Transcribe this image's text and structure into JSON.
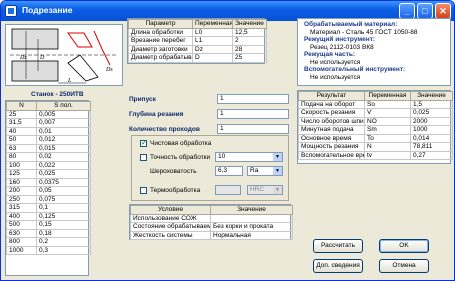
{
  "window": {
    "title": "Подрезание"
  },
  "geo_table": {
    "headers": [
      "Параметр",
      "Переменная",
      "Значение"
    ],
    "rows": [
      [
        "Длина обработки",
        "L0",
        "12,5"
      ],
      [
        "Врезание перебег",
        "L1",
        "2"
      ],
      [
        "Диаметр заготовки",
        "Dz",
        "28"
      ],
      [
        "Диаметр обрабатываемой",
        "D",
        "25"
      ]
    ]
  },
  "material": {
    "h1": "Обрабатываемый материал:",
    "v1": "Материал - Сталь 45 ГОСТ 1050-88",
    "h2": "Режущий инструмент:",
    "v2": "Резец 2112-0103 ВК8",
    "h3": "Режущая часть:",
    "v3": "Не используется",
    "h4": "Вспомогательный инструмент:",
    "v4": "Не используется"
  },
  "machine": {
    "title": "Станок - 250ИТВ",
    "headers": [
      "N",
      "S пол."
    ],
    "rows": [
      [
        "25",
        "0,005"
      ],
      [
        "31,5",
        "0,007"
      ],
      [
        "40",
        "0,01"
      ],
      [
        "50",
        "0,012"
      ],
      [
        "63",
        "0,015"
      ],
      [
        "80",
        "0,02"
      ],
      [
        "100",
        "0,022"
      ],
      [
        "125",
        "0,025"
      ],
      [
        "160",
        "0,0375"
      ],
      [
        "200",
        "0,05"
      ],
      [
        "250",
        "0,075"
      ],
      [
        "315",
        "0,1"
      ],
      [
        "400",
        "0,125"
      ],
      [
        "500",
        "0,15"
      ],
      [
        "630",
        "0,18"
      ],
      [
        "800",
        "0,2"
      ],
      [
        "1000",
        "0,3"
      ]
    ]
  },
  "inputs": {
    "pripusk_label": "Припуск",
    "pripusk_value": "1",
    "glubina_label": "Глубина резания",
    "glubina_value": "1",
    "prohodov_label": "Количество проходов",
    "prohodov_value": "1"
  },
  "options": {
    "finish_label": "Чистовая обработка",
    "accuracy_label": "Точность обработки",
    "accuracy_value": "10",
    "roughness_label": "Шероховатость",
    "roughness_value": "6,3",
    "roughness_unit": "Ra",
    "heat_label": "Термообработка",
    "heat_unit": "HRC"
  },
  "conditions": {
    "headers": [
      "Условие",
      "Значение"
    ],
    "rows": [
      [
        "Использование СОЖ",
        ""
      ],
      [
        "Состояние обрабатываемой",
        "Без корки и проката"
      ],
      [
        "Жесткость системы",
        "Нормальная"
      ]
    ]
  },
  "results": {
    "headers": [
      "Результат",
      "Переменная",
      "Значение"
    ],
    "rows": [
      [
        "Подача на оборот",
        "So",
        "1,5"
      ],
      [
        "Скорость резания",
        "V",
        "0,025"
      ],
      [
        "Число оборотов шпинделя",
        "NO",
        "2000"
      ],
      [
        "Минутная подача",
        "Sm",
        "1000"
      ],
      [
        "Основное время",
        "To",
        "0,014"
      ],
      [
        "Мощность резания",
        "N",
        "78,811"
      ],
      [
        "Вспомогательное время",
        "tv",
        "0,27"
      ]
    ]
  },
  "buttons": {
    "calculate": "Рассчитать",
    "ok": "OK",
    "details": "Доп. сведения",
    "cancel": "Отмена"
  },
  "drawing_labels": {
    "dz": "Dz",
    "d": "D",
    "l": "L",
    "ds": "Ds"
  }
}
